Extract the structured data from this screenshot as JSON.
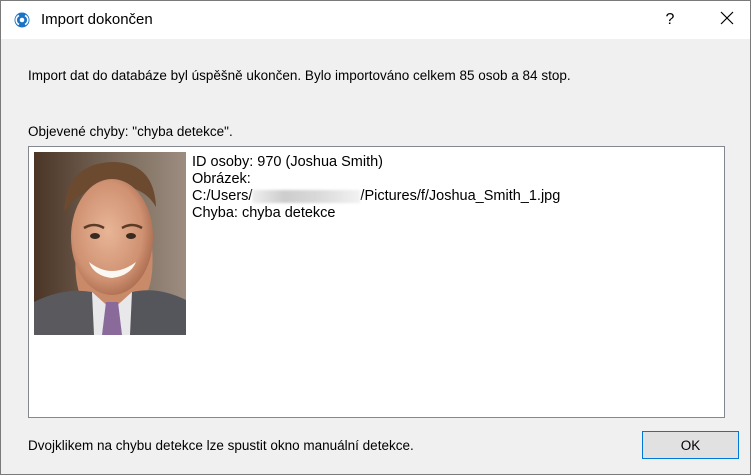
{
  "window": {
    "title": "Import dokončen",
    "help_label": "?",
    "icon": "app-face-icon",
    "close_icon": "close-icon"
  },
  "summary_text": "Import dat do databáze byl úspěšně ukončen. Bylo importováno celkem 85 osob a 84 stop.",
  "errors_label": "Objevené chyby: \"chyba detekce\".",
  "errors": [
    {
      "thumbnail": "person-photo",
      "id_line": "ID osoby: 970 (Joshua Smith)",
      "image_label": "Obrázek:",
      "path_prefix": "C:/Users/",
      "path_suffix": "/Pictures/f/Joshua_Smith_1.jpg",
      "error_line": "Chyba: chyba detekce"
    }
  ],
  "hint_text": "Dvojklikem na chybu detekce lze spustit okno manuální detekce.",
  "ok_label": "OK",
  "colors": {
    "accent": "#0078d7",
    "dialog_bg": "#f0f0f0"
  }
}
